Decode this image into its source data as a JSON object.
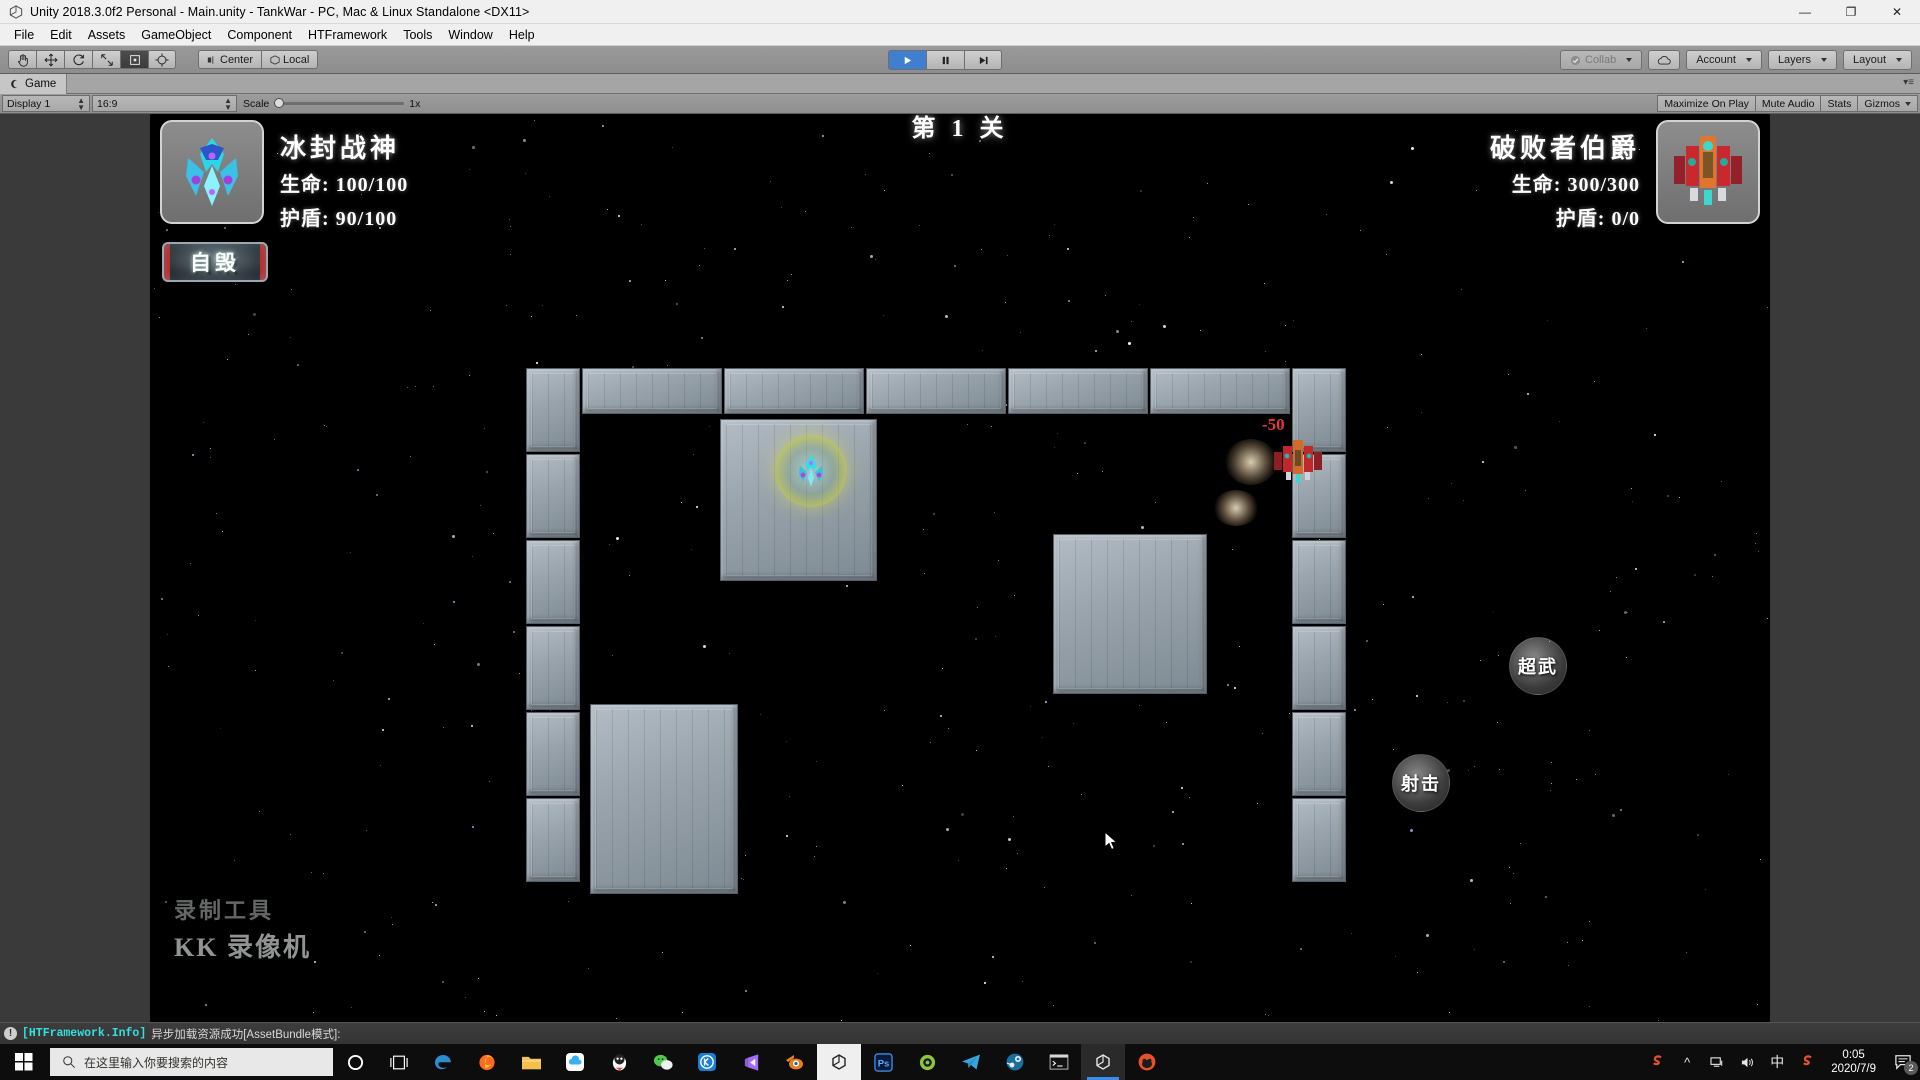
{
  "window": {
    "title": "Unity 2018.3.0f2 Personal - Main.unity - TankWar - PC, Mac & Linux Standalone <DX11>",
    "minimize": "—",
    "maximize": "❐",
    "close": "✕"
  },
  "menu": {
    "items": [
      "File",
      "Edit",
      "Assets",
      "GameObject",
      "Component",
      "HTFramework",
      "Tools",
      "Window",
      "Help"
    ]
  },
  "toolbar": {
    "tools": [
      "hand-tool",
      "move-tool",
      "rotate-tool",
      "scale-tool",
      "rect-tool",
      "transform-tool"
    ],
    "pivot": "Center",
    "space": "Local",
    "play": "▶",
    "pause": "⏸",
    "step": "⏭",
    "collab": "Collab",
    "cloud": "cloud-icon",
    "account": "Account",
    "layers": "Layers",
    "layout": "Layout"
  },
  "panel": {
    "tab_label": "Game"
  },
  "game_toolbar": {
    "display": "Display 1",
    "aspect": "16:9",
    "scale_label": "Scale",
    "scale_value": "1x",
    "maximize_on_play": "Maximize On Play",
    "mute_audio": "Mute Audio",
    "stats": "Stats",
    "gizmos": "Gizmos"
  },
  "hud": {
    "level": "第 1 关",
    "self_destruct": "自毁",
    "player": {
      "name": "冰封战神",
      "hp_label": "生命",
      "hp_value": "100/100",
      "shield_label": "护盾",
      "shield_value": "90/100"
    },
    "enemy": {
      "name": "破败者伯爵",
      "hp_label": "生命",
      "hp_value": "300/300",
      "shield_label": "护盾",
      "shield_value": "0/0"
    },
    "buttons": {
      "super_weapon": "超武",
      "fire": "射击"
    },
    "damage_popup": "-50"
  },
  "watermark": {
    "line1": "录制工具",
    "line2": "KK 录像机"
  },
  "status": {
    "icon": "!",
    "tag": "[HTFramework.Info]",
    "message": "异步加载资源成功[AssetBundle模式]:"
  },
  "taskbar": {
    "start": "windows-logo",
    "search_placeholder": "在这里输入你要搜索的内容",
    "items": [
      "cortana-icon",
      "task-view-icon",
      "edge-icon",
      "firefox-icon",
      "file-explorer-icon",
      "baidu-netdisk-icon",
      "qq-icon",
      "wechat-icon",
      "kuaishou-icon",
      "visual-studio-icon",
      "blender-icon",
      "unity-hub-icon",
      "photoshop-icon",
      "gitkraken-icon",
      "telegram-icon",
      "steam-icon",
      "terminal-icon",
      "unity-editor-icon",
      "kk-recorder-icon"
    ],
    "tray": [
      "sogou-icon",
      "chevron-up-icon",
      "network-icon",
      "volume-icon",
      "ime-cn-icon",
      "sogou-pinyin-icon"
    ],
    "time": "0:05",
    "date": "2020/7/9",
    "notification_count": "2"
  },
  "colors": {
    "unity_chrome": "#8d8d8d",
    "taskbar": "#0d0d0d",
    "accent_blue": "#3a8ee6",
    "status_cyan": "#34e0e0",
    "damage_red": "#e03a3a",
    "shield_yellow": "#d6d63c"
  }
}
